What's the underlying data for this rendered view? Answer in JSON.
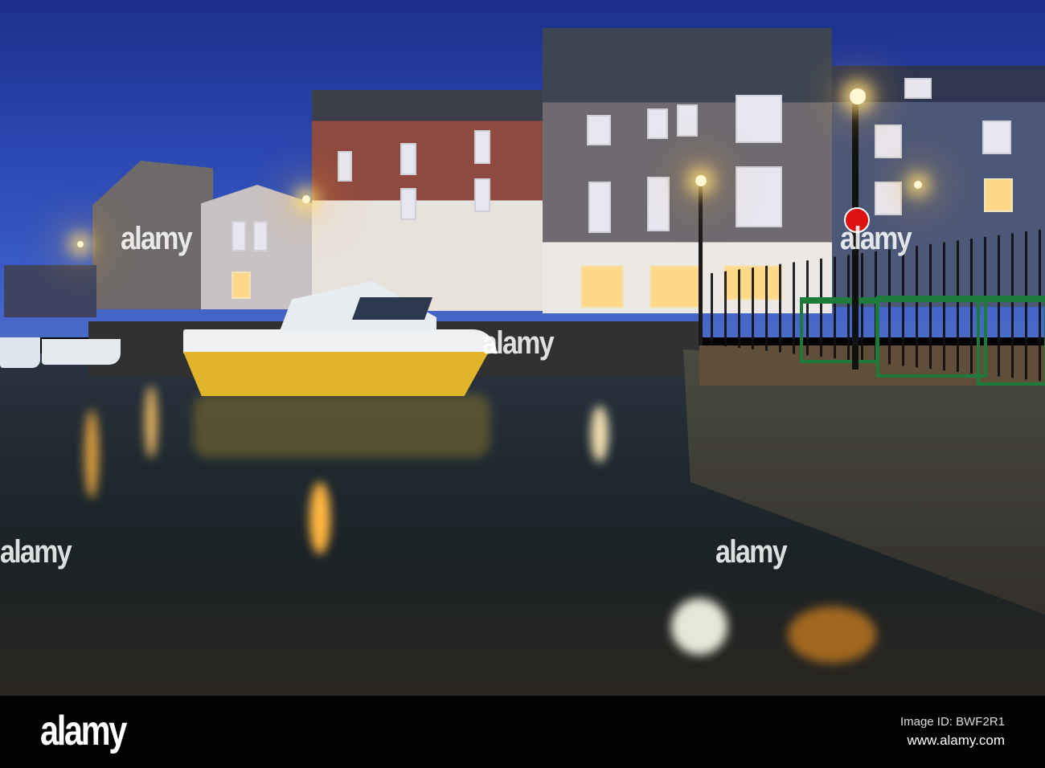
{
  "watermark": {
    "text": "alamy"
  },
  "footer": {
    "logo": "alamy",
    "image_id": "Image ID: BWF2R1",
    "url": "www.alamy.com"
  },
  "colors": {
    "sky": "#2b47b0",
    "boat_hull": "#e1b52a",
    "railing": "#1e7a3a"
  }
}
